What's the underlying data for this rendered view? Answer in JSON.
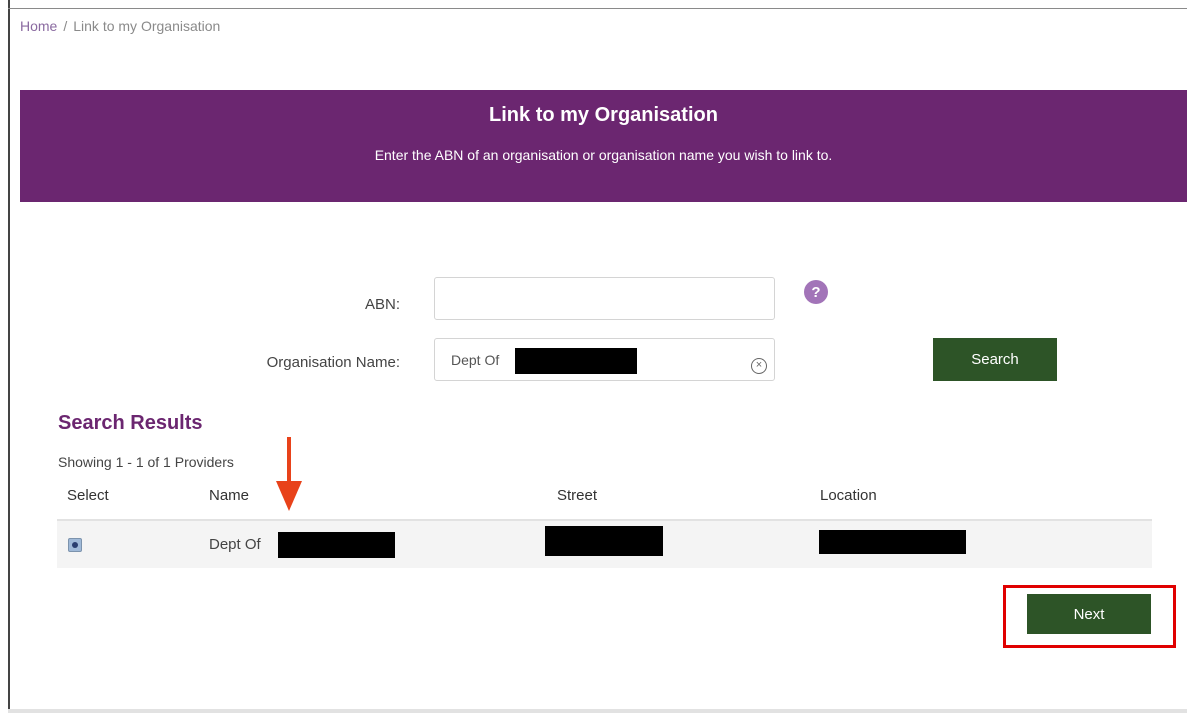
{
  "breadcrumb": {
    "home": "Home",
    "separator": "/",
    "current": "Link to my Organisation"
  },
  "banner": {
    "title": "Link to my Organisation",
    "subtitle": "Enter the ABN of an organisation or organisation name you wish to link to."
  },
  "form": {
    "abn_label": "ABN:",
    "abn_value": "",
    "help_symbol": "?",
    "org_label": "Organisation Name:",
    "org_value": "Dept Of",
    "clear_symbol": "×",
    "search_label": "Search"
  },
  "results": {
    "title": "Search Results",
    "showing": "Showing 1 - 1 of 1 Providers",
    "columns": {
      "select": "Select",
      "name": "Name",
      "street": "Street",
      "location": "Location"
    },
    "rows": [
      {
        "name": "Dept Of",
        "selected": true
      }
    ]
  },
  "actions": {
    "next_label": "Next"
  },
  "colors": {
    "banner": "#6b2670",
    "button": "#2d5427",
    "highlight": "#e00000",
    "arrow": "#e8421a"
  }
}
